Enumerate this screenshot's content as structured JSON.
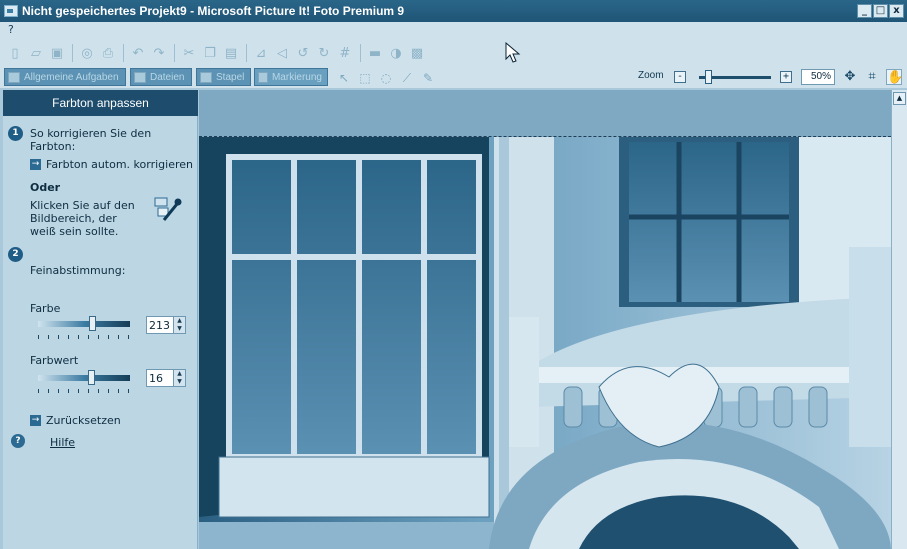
{
  "window": {
    "title": "Nicht gespeichertes Projekt9 - Microsoft Picture It! Foto Premium 9",
    "minimize_glyph": "_",
    "maximize_glyph": "□",
    "close_glyph": "x"
  },
  "menubar": {
    "items": [
      "?"
    ]
  },
  "toolbar": {
    "icons": [
      "new-icon",
      "open-icon",
      "save-icon",
      "print-preview-icon",
      "print-icon",
      "undo-icon",
      "redo-icon",
      "cut-icon",
      "copy-icon",
      "paste-icon",
      "flip-icon",
      "mirror-icon",
      "rotate-left-icon",
      "rotate-right-icon",
      "crop-icon",
      "brightness-icon",
      "contrast-icon",
      "image-icon"
    ]
  },
  "tabs": [
    {
      "label": "Allgemeine Aufgaben"
    },
    {
      "label": "Dateien"
    },
    {
      "label": "Stapel"
    },
    {
      "label": "Markierung"
    }
  ],
  "tools": [
    "pointer-icon",
    "select-icon",
    "lasso-icon",
    "magic-wand-icon",
    "brush-icon"
  ],
  "zoom": {
    "label": "Zoom",
    "minus": "-",
    "plus": "+",
    "value": "50%",
    "level_fraction": 0.12
  },
  "panel": {
    "header": "Farbton anpassen",
    "step1_num": "1",
    "step1_line1": "So korrigieren Sie den",
    "step1_line2": "Farbton:",
    "auto_link": "Farbton autom. korrigieren",
    "oder": "Oder",
    "click_line1": "Klicken Sie auf den",
    "click_line2": "Bildbereich, der",
    "click_line3": "weiß sein sollte.",
    "step2_num": "2",
    "fine_label": "Feinabstimmung:",
    "farbe_label": "Farbe",
    "farbe_value": "213",
    "farbe_fraction": 0.59,
    "farbwert_label": "Farbwert",
    "farbwert_value": "16",
    "farbwert_fraction": 0.58,
    "reset_link": "Zurücksetzen",
    "help_link": "Hilfe",
    "help_glyph": "?",
    "arrow_glyph": "→"
  },
  "scrollbar": {
    "up_glyph": "▲"
  },
  "colors": {
    "titlebar": "#1f5577",
    "panel_header": "#1d4c6c",
    "tint": "#3b7ea6"
  }
}
